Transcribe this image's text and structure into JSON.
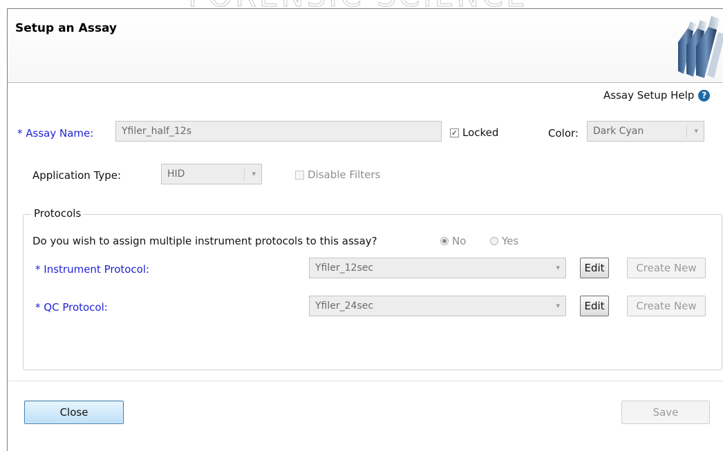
{
  "watermark": {
    "text": "FORENSIC SCIENCE"
  },
  "header": {
    "title": "Setup an Assay"
  },
  "help": {
    "label": "Assay Setup Help",
    "icon": "?"
  },
  "assay": {
    "name_label": "Assay Name:",
    "name_value": "Yfiler_half_12s",
    "locked_label": "Locked",
    "locked_checked": "✓",
    "color_label": "Color:",
    "color_value": "Dark Cyan"
  },
  "application": {
    "type_label": "Application Type:",
    "type_value": "HID",
    "disable_filters_label": "Disable Filters"
  },
  "protocols": {
    "legend": "Protocols",
    "multiple_question": "Do you wish to assign multiple instrument protocols to this assay?",
    "radio_no": "No",
    "radio_yes": "Yes",
    "instrument_label": "Instrument Protocol:",
    "instrument_value": "Yfiler_12sec",
    "qc_label": "QC Protocol:",
    "qc_value": "Yfiler_24sec",
    "edit_label": "Edit",
    "create_new_label": "Create New"
  },
  "footer": {
    "close_label": "Close",
    "save_label": "Save"
  },
  "required_marker": "*",
  "colors": {
    "required_label": "#2222d8",
    "close_button": "#bfe0f8",
    "help_icon": "#1e6aa8"
  }
}
